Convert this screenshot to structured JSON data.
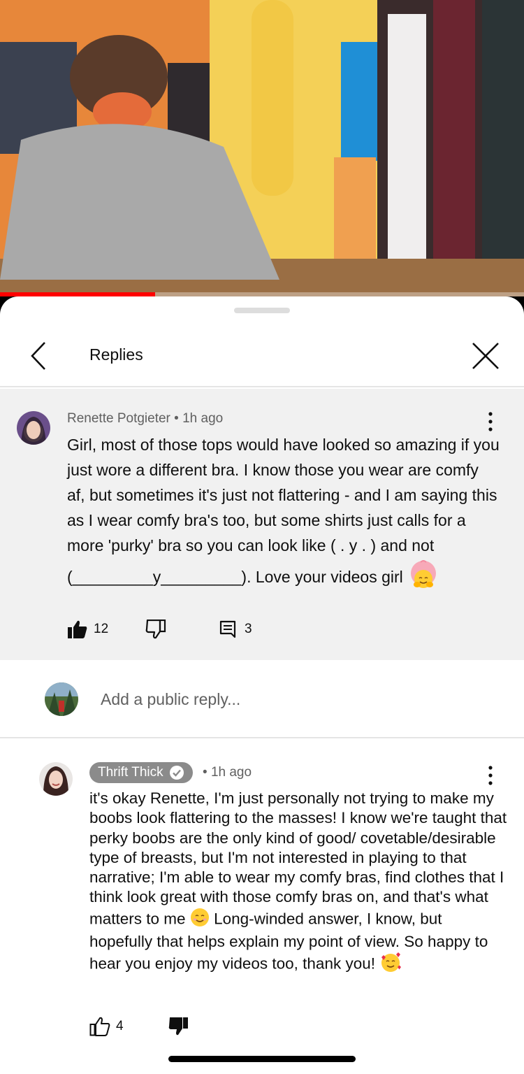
{
  "video": {
    "progress_percent": 29.6
  },
  "header": {
    "title": "Replies"
  },
  "parent_comment": {
    "author": "Renette Potgieter",
    "time": "1h ago",
    "text": "Girl, most of those tops would have looked so amazing if you just wore a different bra. I know those you wear are comfy af, but sometimes it's just not flattering - and I am saying this as I wear comfy bra's too, but some shirts just calls for a more 'purky' bra so you can look like ( . y . ) and not (_________y_________). Love your videos girl",
    "like_count": "12",
    "reply_count": "3"
  },
  "reply_input": {
    "placeholder": "Add a public reply..."
  },
  "reply": {
    "author": "Thrift Thick",
    "time": "1h ago",
    "text": "it's okay Renette, I'm just personally not trying to make my boobs look flattering to the masses! I know we're taught that perky boobs are the only kind of good/ covetable/desirable type of breasts, but I'm not interested in playing to that narrative; I'm able to wear my comfy bras, find clothes that I think look great with those comfy bras on, and that's what matters to me",
    "text_2": "Long-winded answer, I know, but hopefully that helps explain my point of view. So happy to hear you enjoy my videos too, thank you!",
    "like_count": "4"
  },
  "colors": {
    "accent": "#ff0000",
    "sheet_bg": "#ffffff",
    "highlight_bg": "#f1f1f1",
    "author_chip": "#8b8b8b"
  },
  "icons": [
    "chevron-left-icon",
    "close-icon",
    "more-vert-icon",
    "thumb-up-filled-icon",
    "thumb-down-icon",
    "comment-icon",
    "verified-check-icon",
    "thumb-up-outline-icon",
    "thumb-down-filled-icon",
    "hugging-face-emoji",
    "smiling-face-emoji",
    "smiling-hearts-emoji"
  ]
}
